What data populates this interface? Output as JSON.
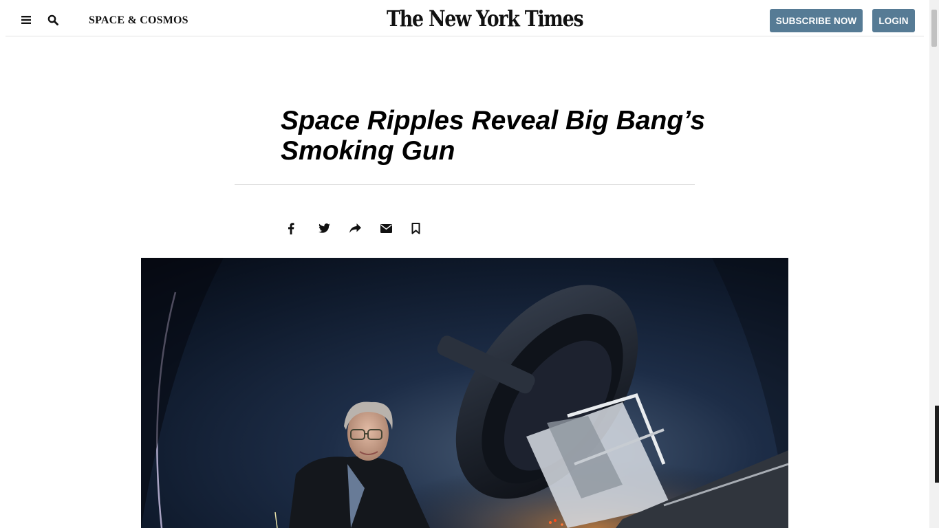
{
  "header": {
    "section_label": "SPACE & COSMOS",
    "logo_text": "The New York Times",
    "subscribe_label": "SUBSCRIBE NOW",
    "login_label": "LOGIN",
    "menu_icon": "hamburger-menu-icon",
    "search_icon": "search-icon",
    "button_color": "#567b95"
  },
  "article": {
    "headline": "Space Ripples Reveal Big Bang’s Smoking Gun"
  },
  "share_bar": {
    "icons": [
      "facebook-icon",
      "twitter-icon",
      "share-icon",
      "email-icon",
      "bookmark-icon"
    ]
  },
  "photo": {
    "subject": "scientist-and-telescope-photo"
  }
}
